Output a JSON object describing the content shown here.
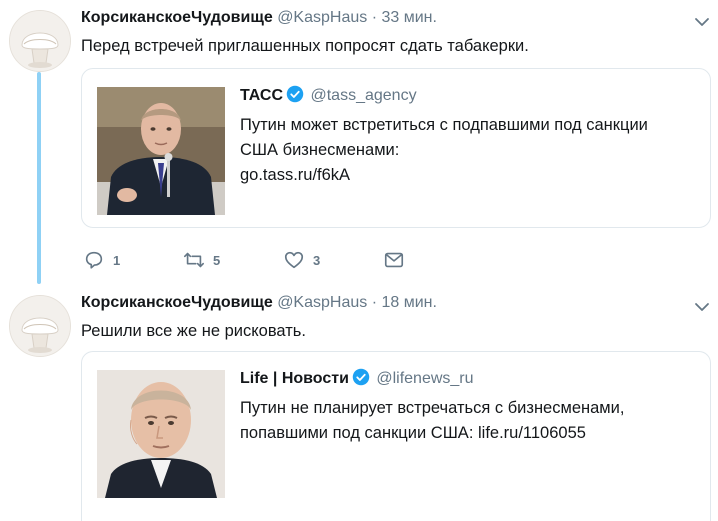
{
  "tweets": [
    {
      "author": "КорсиканскоеЧудовище",
      "handle": "@KaspHaus",
      "separator": "·",
      "time": "33 мин.",
      "text": "Перед встречей приглашенных попросят сдать табакерки.",
      "quote": {
        "name": "ТАСС",
        "handle": "@tass_agency",
        "text_line1": "Путин может встретиться с подпавшими под санкции",
        "text_line2": "США бизнесменами:",
        "text_line3": "go.tass.ru/f6kA"
      },
      "actions": {
        "replies": "1",
        "retweets": "5",
        "likes": "3"
      }
    },
    {
      "author": "КорсиканскоеЧудовище",
      "handle": "@KaspHaus",
      "separator": "·",
      "time": "18 мин.",
      "text": "Решили все же не рисковать.",
      "quote": {
        "name": "Life | Новости",
        "handle": "@lifenews_ru",
        "text_line1": "Путин не планирует встречаться с бизнесменами,",
        "text_line2": "попавшими под санкции США: life.ru/1106055"
      }
    }
  ],
  "icons": {
    "reply": "reply-icon",
    "retweet": "retweet-icon",
    "like": "heart-icon",
    "dm": "envelope-icon",
    "verified": "verified-badge-icon",
    "menu": "chevron-down-icon"
  },
  "colors": {
    "text": "#14171a",
    "muted": "#657786",
    "verified": "#1da1f2",
    "thread_line": "#8fd1f5",
    "border": "#e1e8ed"
  }
}
